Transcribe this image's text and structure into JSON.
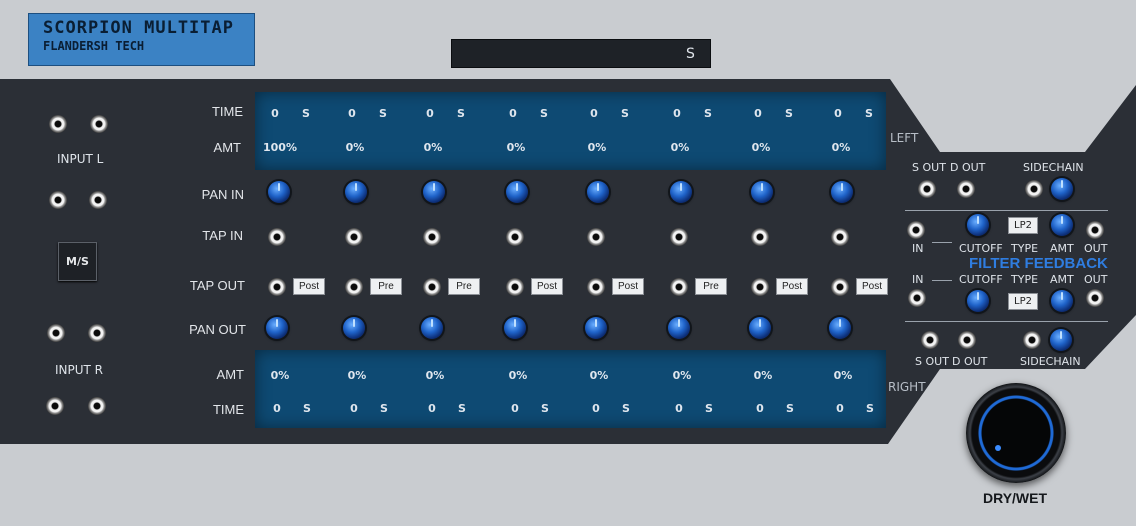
{
  "header": {
    "title": "SCORPION MULTITAP",
    "subtitle": "FLANDERSH TECH",
    "display_value": "",
    "display_unit": "S"
  },
  "left": {
    "input_l": "INPUT L",
    "input_r": "INPUT R",
    "ms_button": "M/S"
  },
  "rows": {
    "time": "TIME",
    "amt": "AMT",
    "pan_in": "PAN IN",
    "tap_in": "TAP IN",
    "tap_out": "TAP OUT",
    "pan_out": "PAN OUT",
    "amt_bottom": "AMT",
    "time_bottom": "TIME"
  },
  "taps": [
    {
      "time_top": "0",
      "amt_top": "100%",
      "mode": "Post",
      "amt_bottom": "0%",
      "time_bottom": "0"
    },
    {
      "time_top": "0",
      "amt_top": "0%",
      "mode": "Pre",
      "amt_bottom": "0%",
      "time_bottom": "0"
    },
    {
      "time_top": "0",
      "amt_top": "0%",
      "mode": "Pre",
      "amt_bottom": "0%",
      "time_bottom": "0"
    },
    {
      "time_top": "0",
      "amt_top": "0%",
      "mode": "Post",
      "amt_bottom": "0%",
      "time_bottom": "0"
    },
    {
      "time_top": "0",
      "amt_top": "0%",
      "mode": "Post",
      "amt_bottom": "0%",
      "time_bottom": "0"
    },
    {
      "time_top": "0",
      "amt_top": "0%",
      "mode": "Pre",
      "amt_bottom": "0%",
      "time_bottom": "0"
    },
    {
      "time_top": "0",
      "amt_top": "0%",
      "mode": "Post",
      "amt_bottom": "0%",
      "time_bottom": "0"
    },
    {
      "time_top": "0",
      "amt_top": "0%",
      "mode": "Post",
      "amt_bottom": "0%",
      "time_bottom": "0"
    }
  ],
  "time_unit": "S",
  "right": {
    "left_label": "LEFT",
    "right_label": "RIGHT",
    "s_out": "S OUT",
    "d_out": "D OUT",
    "sidechain": "SIDECHAIN",
    "in": "IN",
    "cutoff": "CUTOFF",
    "type": "TYPE",
    "amt": "AMT",
    "out": "OUT",
    "filter_type_top": "LP2",
    "filter_type_bottom": "LP2",
    "filter_feedback": "FILTER FEEDBACK",
    "drywet": "DRY/WET"
  },
  "colors": {
    "panel": "#2b2f36",
    "lcd": "#0e4a73",
    "accent": "#2f7de0",
    "frame": "#c9ccd0"
  }
}
